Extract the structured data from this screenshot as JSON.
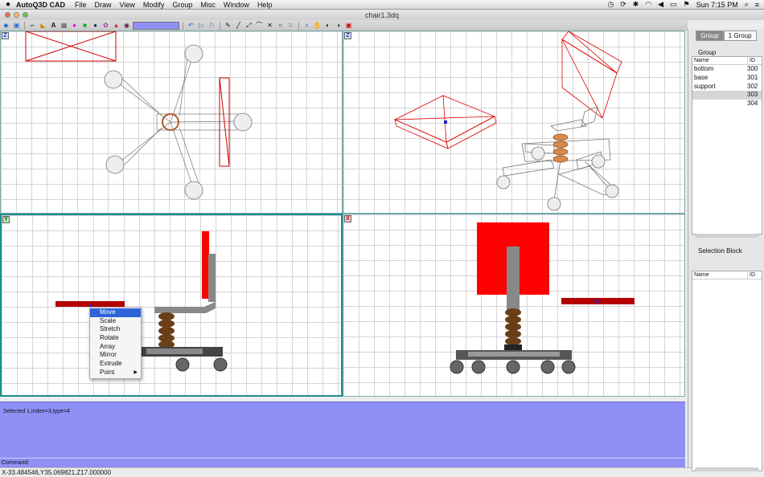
{
  "menubar": {
    "app_name": "AutoQ3D CAD",
    "items": [
      "File",
      "Draw",
      "View",
      "Modify",
      "Group",
      "Misc",
      "Window",
      "Help"
    ],
    "clock": "Sun 7:15 PM"
  },
  "window": {
    "title": "chair1.3dq"
  },
  "viewports": {
    "top_left": {
      "badge": "Z"
    },
    "top_right": {
      "badge": "Z"
    },
    "bottom_left": {
      "badge": "Y"
    },
    "bottom_right": {
      "badge": "X"
    }
  },
  "context_menu": {
    "items": [
      "Move",
      "Scale",
      "Stretch",
      "Rotate",
      "Array",
      "Mirror",
      "Extrude",
      "Point"
    ],
    "selected": "Move"
  },
  "status": {
    "message": "Selected 1,index=3,type=4",
    "command_label": "Command:",
    "coordinates": "X-33.484546,Y35.069821,Z17.000000"
  },
  "right_panel": {
    "tabs": [
      "Group",
      "1 Group"
    ],
    "group_title": "Group",
    "columns": [
      "Name",
      "ID"
    ],
    "groups": [
      {
        "name": "bottom",
        "id": "300"
      },
      {
        "name": "base",
        "id": "301"
      },
      {
        "name": "support",
        "id": "302"
      },
      {
        "name": "",
        "id": "303"
      },
      {
        "name": "",
        "id": "304"
      }
    ],
    "selected_id": "303",
    "selection_block_title": "Selection Block",
    "selection_columns": [
      "Name",
      "ID"
    ]
  },
  "colors": {
    "status_bg": "#8f8ff5",
    "active_viewport": "#1a8e8e",
    "model_red": "#ff0000",
    "selection_blue": "#2f64d8"
  }
}
